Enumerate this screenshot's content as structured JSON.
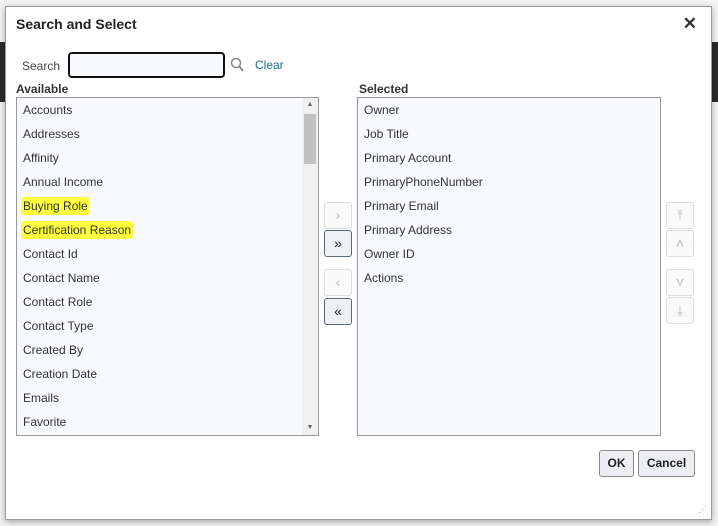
{
  "dialog": {
    "title": "Search and Select",
    "close_label": "✕"
  },
  "search": {
    "label": "Search",
    "value": "",
    "placeholder": "",
    "clear_label": "Clear"
  },
  "available": {
    "header": "Available",
    "items": [
      {
        "label": "Accounts",
        "highlighted": false
      },
      {
        "label": "Addresses",
        "highlighted": false
      },
      {
        "label": "Affinity",
        "highlighted": false
      },
      {
        "label": "Annual Income",
        "highlighted": false
      },
      {
        "label": "Buying Role",
        "highlighted": true
      },
      {
        "label": "Certification Reason",
        "highlighted": true
      },
      {
        "label": "Contact Id",
        "highlighted": false
      },
      {
        "label": "Contact Name",
        "highlighted": false
      },
      {
        "label": "Contact Role",
        "highlighted": false
      },
      {
        "label": "Contact Type",
        "highlighted": false
      },
      {
        "label": "Created By",
        "highlighted": false
      },
      {
        "label": "Creation Date",
        "highlighted": false
      },
      {
        "label": "Emails",
        "highlighted": false
      },
      {
        "label": "Favorite",
        "highlighted": false
      }
    ]
  },
  "selected": {
    "header": "Selected",
    "items": [
      "Owner",
      "Job Title",
      "Primary Account",
      "PrimaryPhoneNumber",
      "Primary Email",
      "Primary Address",
      "Owner ID",
      "Actions"
    ]
  },
  "shuttle": {
    "move": "›",
    "move_all": "»",
    "remove": "‹",
    "remove_all": "«"
  },
  "reorder": {
    "top": "⤒",
    "up": "˄",
    "down": "˅",
    "bottom": "⤓"
  },
  "footer": {
    "ok": "OK",
    "cancel": "Cancel"
  },
  "colors": {
    "highlight": "#ffff40",
    "link": "#1b6f9a"
  }
}
